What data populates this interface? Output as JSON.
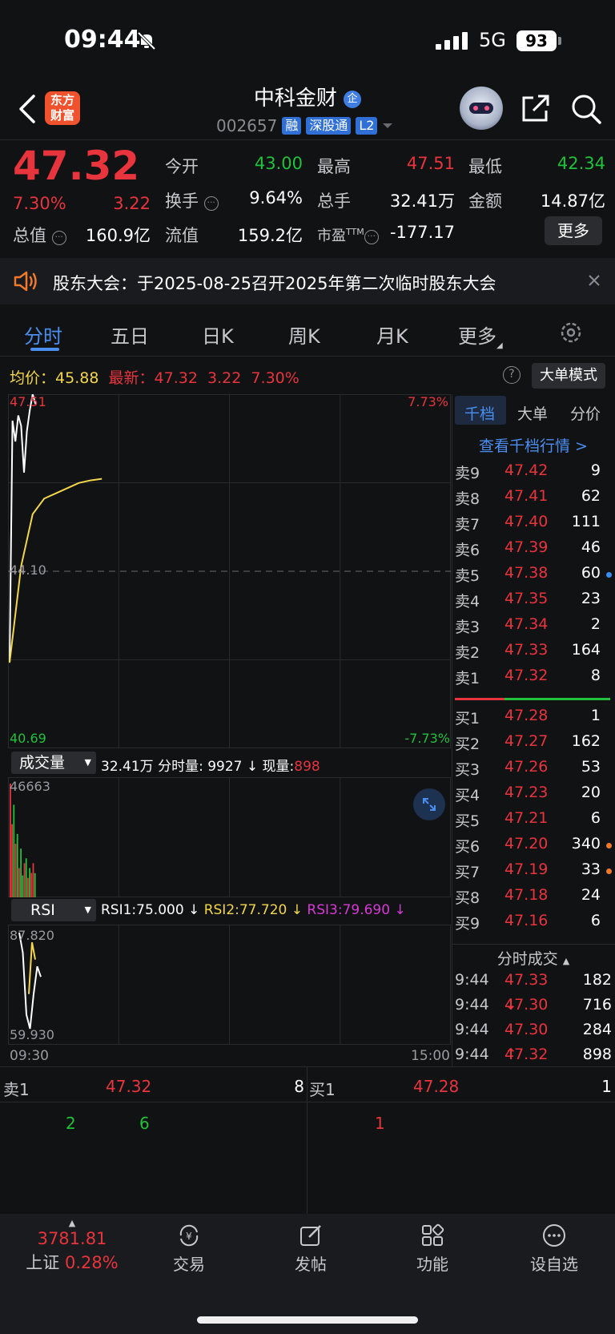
{
  "status_bar": {
    "time": "09:44",
    "network": "5G",
    "battery": "93"
  },
  "header": {
    "logo_text": "东方财富",
    "stock_name": "中科金财",
    "stock_code": "002657",
    "tags": [
      "融",
      "深股通",
      "L2"
    ],
    "enterprise_badge": "企"
  },
  "quote": {
    "price": "47.32",
    "change_pct": "7.30%",
    "change": "3.22",
    "open_label": "今开",
    "open": "43.00",
    "high_label": "最高",
    "high": "47.51",
    "low_label": "最低",
    "low": "42.34",
    "turnover_label": "换手",
    "turnover": "9.64%",
    "total_vol_label": "总手",
    "total_vol": "32.41万",
    "amount_label": "金额",
    "amount": "14.87亿",
    "mktcap_label": "总值",
    "mktcap": "160.9亿",
    "float_label": "流值",
    "float_cap": "159.2亿",
    "pe_label": "市盈",
    "pe_sup": "TTM",
    "pe": "-177.17",
    "more": "更多"
  },
  "notice": {
    "text": "股东大会：于2025-08-25召开2025年第二次临时股东大会"
  },
  "tabs": [
    "分时",
    "五日",
    "日K",
    "周K",
    "月K",
    "更多"
  ],
  "avg_row": {
    "avg_label": "均价：",
    "avg": "45.88",
    "latest_label": "最新：",
    "latest": "47.32",
    "change": "3.22",
    "change_pct": "7.30%",
    "big_order_mode": "大单模式"
  },
  "chart": {
    "y_top": "47.51",
    "y_top_pct": "7.73%",
    "y_mid": "44.10",
    "y_bottom": "40.69",
    "y_bottom_pct": "-7.73%",
    "x_start": "09:30",
    "x_end": "15:00",
    "volume": {
      "selector": "成交量",
      "total": "32.41万",
      "minute_label": "分时量:",
      "minute": "9927 ↓",
      "current_label": "现量:",
      "current": "898",
      "y_max": "46663"
    },
    "rsi": {
      "selector": "RSI",
      "rsi1": "RSI1:75.000 ↓",
      "rsi2": "RSI2:77.720 ↓",
      "rsi3": "RSI3:79.690 ↓",
      "y_max": "87.820",
      "y_min": "59.930"
    }
  },
  "chart_data": {
    "type": "line",
    "price_range": [
      40.69,
      47.51
    ],
    "ref_price": 44.1,
    "price_series": [
      42.34,
      47.0,
      46.6,
      47.1,
      46.9,
      46.0,
      46.8,
      47.2,
      47.51,
      47.32
    ],
    "avg_series": [
      42.34,
      44.2,
      45.2,
      45.5,
      45.6,
      45.7,
      45.8,
      45.85,
      45.88
    ],
    "volume_max": 46663,
    "volumes": [
      46663,
      30000,
      38000,
      22000,
      26000,
      12000,
      20000,
      9000,
      14000,
      16000,
      8000,
      12000,
      10000,
      14000,
      9927
    ],
    "volume_colors": [
      "red",
      "red",
      "green",
      "red",
      "green",
      "red",
      "green",
      "green",
      "red",
      "green",
      "red",
      "green",
      "red",
      "red",
      "green"
    ],
    "rsi_range": [
      59.93,
      87.82
    ],
    "rsi_series": [
      87.82,
      82.0,
      64.0,
      59.93,
      70.0,
      78.0,
      75.0
    ]
  },
  "order_book": {
    "tabs": [
      "千档",
      "大单",
      "分价"
    ],
    "view_link": "查看千档行情 >",
    "asks": [
      {
        "label": "卖9",
        "price": "47.42",
        "vol": "9"
      },
      {
        "label": "卖8",
        "price": "47.41",
        "vol": "62"
      },
      {
        "label": "卖7",
        "price": "47.40",
        "vol": "111"
      },
      {
        "label": "卖6",
        "price": "47.39",
        "vol": "46"
      },
      {
        "label": "卖5",
        "price": "47.38",
        "vol": "60"
      },
      {
        "label": "卖4",
        "price": "47.35",
        "vol": "23"
      },
      {
        "label": "卖3",
        "price": "47.34",
        "vol": "2"
      },
      {
        "label": "卖2",
        "price": "47.33",
        "vol": "164"
      },
      {
        "label": "卖1",
        "price": "47.32",
        "vol": "8"
      }
    ],
    "bids": [
      {
        "label": "买1",
        "price": "47.28",
        "vol": "1"
      },
      {
        "label": "买2",
        "price": "47.27",
        "vol": "162"
      },
      {
        "label": "买3",
        "price": "47.26",
        "vol": "53"
      },
      {
        "label": "买4",
        "price": "47.23",
        "vol": "20"
      },
      {
        "label": "买5",
        "price": "47.21",
        "vol": "6"
      },
      {
        "label": "买6",
        "price": "47.20",
        "vol": "340"
      },
      {
        "label": "买7",
        "price": "47.19",
        "vol": "33"
      },
      {
        "label": "买8",
        "price": "47.18",
        "vol": "24"
      },
      {
        "label": "买9",
        "price": "47.16",
        "vol": "6"
      }
    ],
    "trades_title": "分时成交",
    "trades": [
      {
        "time": "9:44",
        "price": "47.33",
        "arrow": "",
        "vol": "182",
        "color": "green"
      },
      {
        "time": "9:44",
        "price": "47.30",
        "arrow": "↓",
        "vol": "716",
        "color": "green"
      },
      {
        "time": "9:44",
        "price": "47.30",
        "arrow": "",
        "vol": "284",
        "color": "red"
      },
      {
        "time": "9:44",
        "price": "47.32",
        "arrow": "↑",
        "vol": "898",
        "color": "red"
      }
    ]
  },
  "queue": {
    "sell_label": "卖1",
    "sell_price": "47.32",
    "sell_vol": "8",
    "buy_label": "买1",
    "buy_price": "47.28",
    "buy_vol": "1",
    "sell_orders": [
      "2",
      "6"
    ],
    "buy_orders": [
      "1"
    ]
  },
  "bottom_nav": {
    "index_value": "3781.81",
    "index_name": "上证",
    "index_pct": "0.28%",
    "items": [
      "交易",
      "发帖",
      "功能",
      "设自选"
    ]
  },
  "colors": {
    "up": "#e8343d",
    "down": "#1fc23a",
    "accent": "#4a8ff0",
    "avg_line": "#f2d64b"
  }
}
